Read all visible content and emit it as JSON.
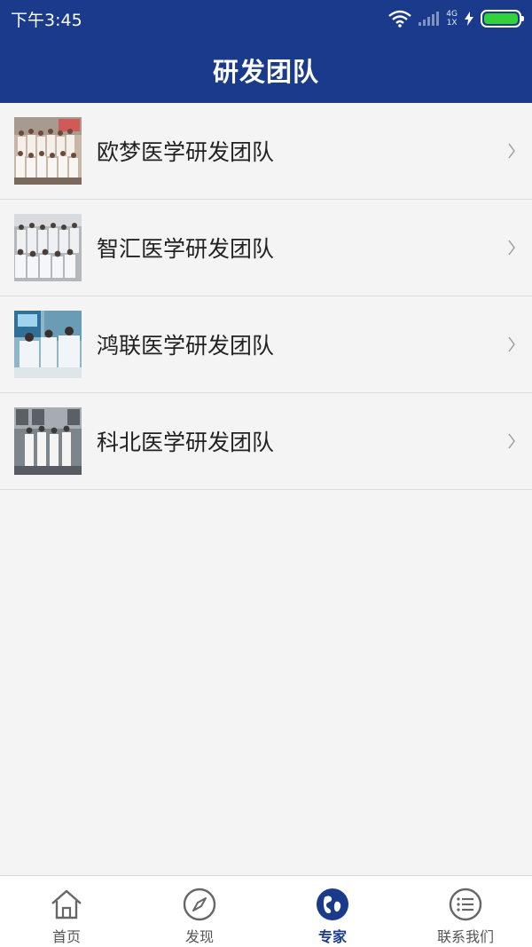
{
  "status_bar": {
    "time": "下午3:45",
    "network_top": "4G",
    "network_bottom": "1X",
    "battery_level": 1.0,
    "battery_color": "#34d23a"
  },
  "header": {
    "title": "研发团队",
    "background": "#1a3a8c"
  },
  "teams": [
    {
      "name": "欧梦医学研发团队",
      "icon": "team-photo"
    },
    {
      "name": "智汇医学研发团队",
      "icon": "team-photo"
    },
    {
      "name": "鸿联医学研发团队",
      "icon": "team-photo"
    },
    {
      "name": "科北医学研发团队",
      "icon": "team-photo"
    }
  ],
  "tabs": [
    {
      "label": "首页",
      "icon": "home-icon",
      "active": false
    },
    {
      "label": "发现",
      "icon": "compass-icon",
      "active": false
    },
    {
      "label": "专家",
      "icon": "globe-icon",
      "active": true
    },
    {
      "label": "联系我们",
      "icon": "list-icon",
      "active": false
    }
  ]
}
